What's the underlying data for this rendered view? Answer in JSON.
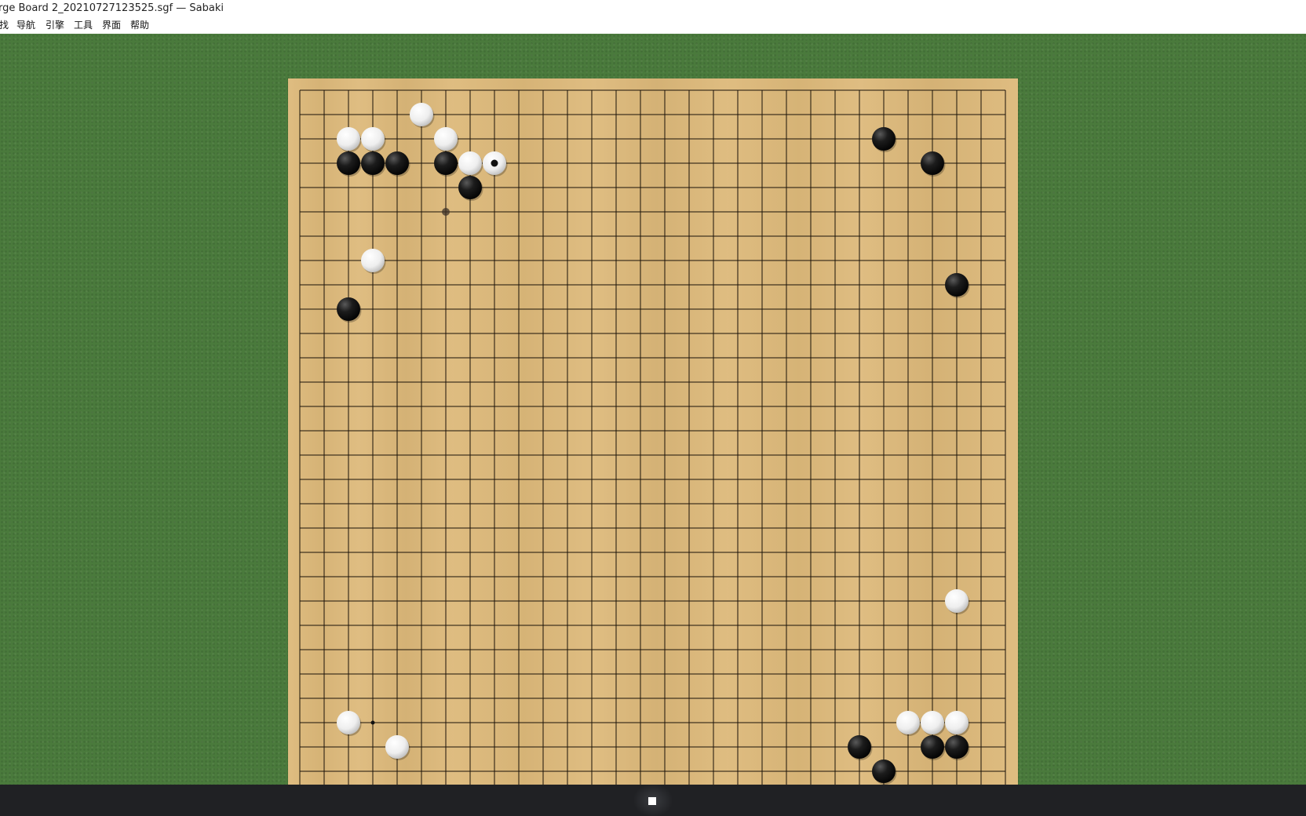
{
  "window": {
    "title": "rge Board 2_20210727123525.sgf — Sabaki"
  },
  "menu": {
    "items": [
      {
        "label": "找"
      },
      {
        "label": "导航"
      },
      {
        "label": "引擎"
      },
      {
        "label": "工具"
      },
      {
        "label": "界面"
      },
      {
        "label": "帮助"
      }
    ]
  },
  "colors": {
    "felt": "#4a7a3c",
    "board": "#ddb97a",
    "grid_line": "#1a1208",
    "black_stone": "#111111",
    "white_stone": "#f2f2f2",
    "taskbar": "#202124"
  },
  "board": {
    "size": 30,
    "black_stones": [
      [
        2,
        3
      ],
      [
        3,
        3
      ],
      [
        4,
        3
      ],
      [
        6,
        3
      ],
      [
        7,
        4
      ],
      [
        2,
        9
      ],
      [
        24,
        2
      ],
      [
        26,
        3
      ],
      [
        27,
        8
      ],
      [
        23,
        27
      ],
      [
        26,
        27
      ],
      [
        27,
        27
      ],
      [
        24,
        28
      ]
    ],
    "white_stones": [
      [
        5,
        1
      ],
      [
        2,
        2
      ],
      [
        3,
        2
      ],
      [
        6,
        2
      ],
      [
        7,
        3
      ],
      [
        8,
        3
      ],
      [
        3,
        7
      ],
      [
        27,
        21
      ],
      [
        2,
        26
      ],
      [
        4,
        27
      ],
      [
        25,
        26
      ],
      [
        26,
        26
      ],
      [
        27,
        26
      ]
    ],
    "last_move": [
      8,
      3
    ],
    "ghost_marks": [
      [
        6,
        5
      ]
    ],
    "point_marks": [
      [
        3,
        26
      ]
    ]
  },
  "taskbar": {
    "app_icon": "sabaki-app-icon"
  }
}
